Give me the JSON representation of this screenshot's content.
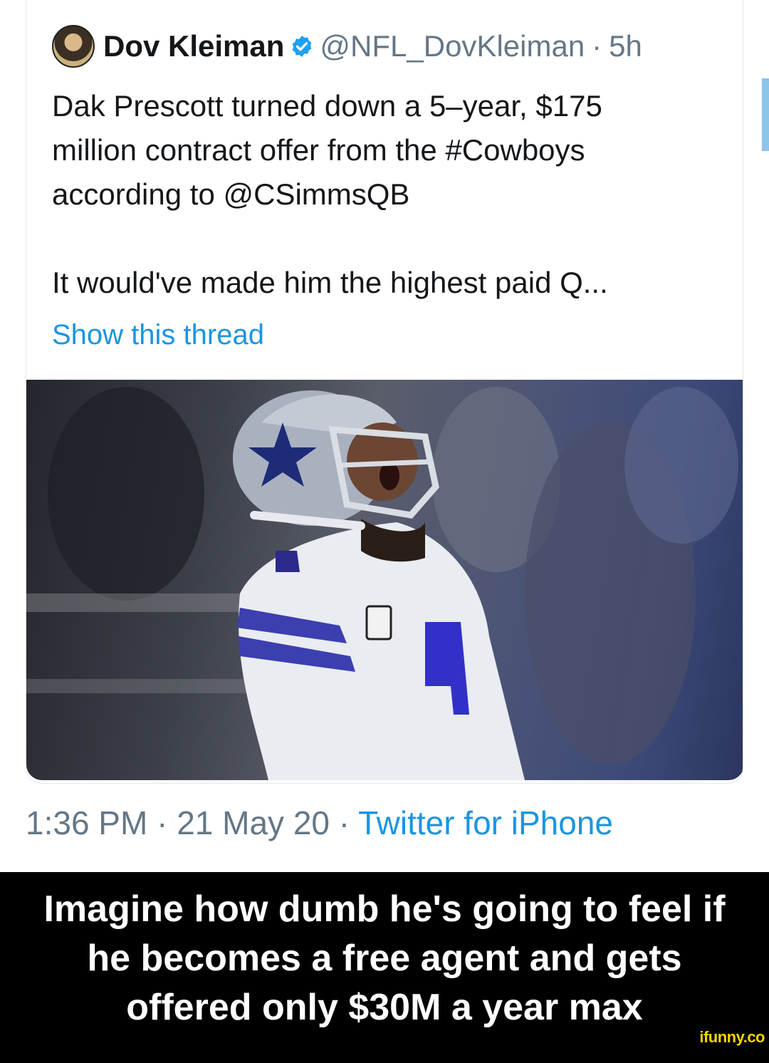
{
  "tweet": {
    "display_name": "Dov Kleiman",
    "handle": "@NFL_DovKleiman",
    "separator": "·",
    "age": "5h",
    "text_line_1": "Dak Prescott turned down a 5–year, $175",
    "text_line_2": "million contract offer from the #Cowboys",
    "text_line_3": "according to @CSimmsQB",
    "text_line_4": "It would've made him the highest paid Q...",
    "show_thread_label": "Show this thread",
    "photo_icon": "football-player-photo",
    "verified_icon": "verified-badge-icon"
  },
  "meta": {
    "time": "1:36 PM",
    "date": "21 May 20",
    "separator": "·",
    "source": "Twitter for iPhone"
  },
  "caption": {
    "line_1": "Imagine how dumb he's going to feel if",
    "line_2": "he becomes a free agent and gets",
    "line_3": "offered only $30M a year max"
  },
  "watermark": "ifunny.co",
  "colors": {
    "link_blue": "#1b95e0",
    "text_dark": "#14171a",
    "text_gray": "#657786",
    "caption_bg": "#000000",
    "watermark_yellow": "#f5d400"
  }
}
